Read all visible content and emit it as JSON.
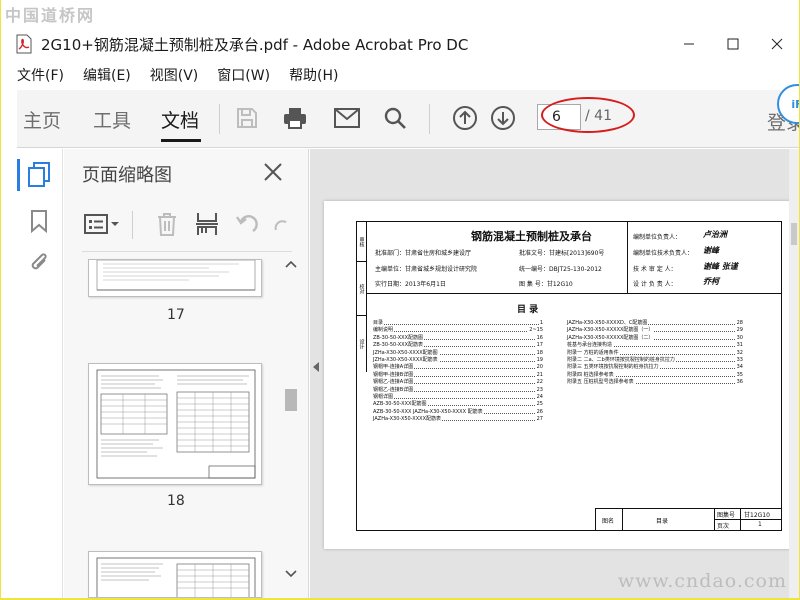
{
  "watermark": {
    "top": "中国道桥网",
    "bottom": "www.cndao.com"
  },
  "window": {
    "title": "2G10+钢筋混凝土预制桩及承台.pdf - Adobe Acrobat Pro DC"
  },
  "menu": [
    "文件(F)",
    "编辑(E)",
    "视图(V)",
    "窗口(W)",
    "帮助(H)"
  ],
  "toolbar": {
    "tabs": [
      "主页",
      "工具",
      "文档"
    ],
    "active_tab": "文档",
    "current_page": "6",
    "total_pages": "/ 41",
    "login": "登录",
    "badge": "iF"
  },
  "thumbnail_panel": {
    "title": "页面缩略图",
    "thumbnails": [
      {
        "label": "17"
      },
      {
        "label": "18"
      }
    ]
  },
  "document": {
    "side_strip": [
      "审核",
      "校对",
      "设计"
    ],
    "title": "钢筋混凝土预制桩及承台",
    "header_left": [
      {
        "label": "批准部门：",
        "value": "甘肃省住房和城乡建设厅"
      },
      {
        "label": "主编单位：",
        "value": "甘肃省城乡规划设计研究院"
      },
      {
        "label": "实行日期：",
        "value": "2013年6月1日"
      }
    ],
    "header_mid": [
      {
        "label": "批准文号：",
        "value": "甘建标[2013]690号"
      },
      {
        "label": "统一编号：",
        "value": "DBJT25-130-2012"
      },
      {
        "label": "图 集 号：",
        "value": "甘12G10"
      }
    ],
    "header_right": [
      {
        "label": "编制单位负责人：",
        "sig": "卢治洲"
      },
      {
        "label": "编制单位技术负责人：",
        "sig": "谢峰"
      },
      {
        "label": "技 术 审 定 人：",
        "sig": "谢峰 张谨"
      },
      {
        "label": "设 计 负 责 人：",
        "sig": "乔柯"
      }
    ],
    "toc_heading": "目    录",
    "toc_left": [
      {
        "t": "目录",
        "p": "1"
      },
      {
        "t": "编制说明",
        "p": "2~15"
      },
      {
        "t": "ZB-30-50-XXX配筋图",
        "p": "16"
      },
      {
        "t": "ZB-30-50-XXX配筋表",
        "p": "17"
      },
      {
        "t": "JZHa-X30-X50-XXXX配筋图",
        "p": "18"
      },
      {
        "t": "JZHa-X30-X50-XXXX配筋表",
        "p": "19"
      },
      {
        "t": "钢帽甲-连接A详图",
        "p": "20"
      },
      {
        "t": "钢帽甲-连接B详图",
        "p": "21"
      },
      {
        "t": "钢帽乙-连接A详图",
        "p": "22"
      },
      {
        "t": "钢帽乙-连接B详图",
        "p": "23"
      },
      {
        "t": "钢帽详图",
        "p": "24"
      },
      {
        "t": "AZB-30-50-XXX配筋图",
        "p": "25"
      },
      {
        "t": "AZB-30-50-XXX  JAZHa-X30-X50-XXXX 配筋表",
        "p": "26"
      },
      {
        "t": "JAZHa-X30-X50-XXXX配筋表",
        "p": "27"
      }
    ],
    "toc_right": [
      {
        "t": "JAZHa-X30-X50-XXXXD、C配筋图",
        "p": "28"
      },
      {
        "t": "JAZHa-X30-X50-XXXXX配筋图（一）",
        "p": "29"
      },
      {
        "t": "JAZHa-X30-X50-XXXXX配筋图（二）",
        "p": "30"
      },
      {
        "t": "桩基与承台连接构造",
        "p": "31"
      },
      {
        "t": "附录一  方桩的适用条件",
        "p": "32"
      },
      {
        "t": "附录二  二a、二b类环境按抗裂控制的桩身抗拉力",
        "p": "33"
      },
      {
        "t": "附录三  五类环境按抗裂控制的桩身抗拉力",
        "p": "34"
      },
      {
        "t": "附录四  桩选择参考表",
        "p": "35"
      },
      {
        "t": "附录五  压桩机型号选择参考表",
        "p": "36"
      }
    ],
    "title_block": {
      "tuming_label": "图名",
      "tuming": "目录",
      "tujihao_label": "图集号",
      "tujihao": "甘12G10",
      "yeci_label": "页次",
      "yeci": "1"
    }
  }
}
